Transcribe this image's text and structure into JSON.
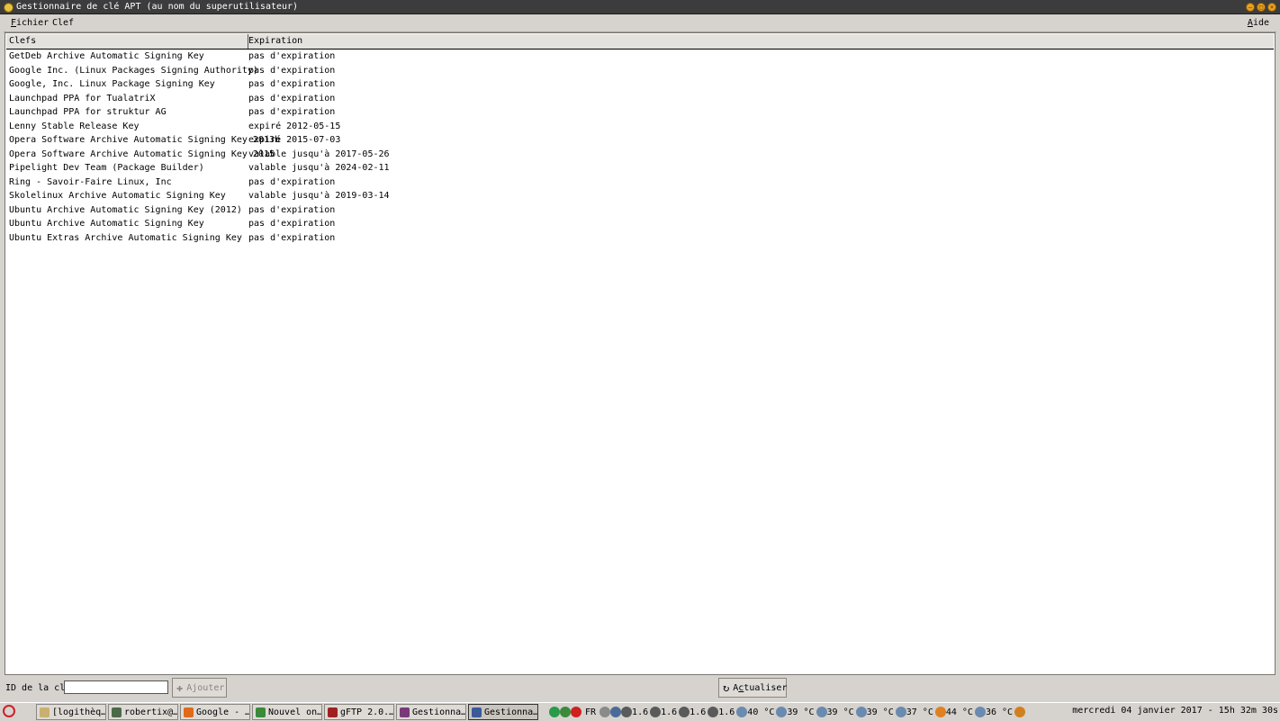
{
  "window": {
    "title": "Gestionnaire de clé APT (au nom du superutilisateur)",
    "buttons": [
      "minimize",
      "maximize",
      "close"
    ]
  },
  "menubar": {
    "file": {
      "mnemonic": "F",
      "rest": "ichier"
    },
    "key": {
      "label": "Clef"
    },
    "help": {
      "mnemonic": "A",
      "rest": "ide"
    }
  },
  "table": {
    "columns": [
      "Clefs",
      "Expiration"
    ],
    "rows": [
      [
        "GetDeb Archive Automatic Signing Key",
        "pas d'expiration"
      ],
      [
        "Google Inc. (Linux Packages Signing Authority)",
        "pas d'expiration"
      ],
      [
        "Google, Inc. Linux Package Signing Key",
        "pas d'expiration"
      ],
      [
        "Launchpad PPA for TualatriX",
        "pas d'expiration"
      ],
      [
        "Launchpad PPA for struktur AG",
        "pas d'expiration"
      ],
      [
        "Lenny Stable Release Key",
        "expiré 2012-05-15"
      ],
      [
        "Opera Software Archive Automatic Signing Key 2013b",
        "expiré 2015-07-03"
      ],
      [
        "Opera Software Archive Automatic Signing Key 2015",
        "valable jusqu'à 2017-05-26"
      ],
      [
        "Pipelight Dev Team (Package Builder)",
        "valable jusqu'à 2024-02-11"
      ],
      [
        "Ring - Savoir-Faire Linux, Inc",
        "pas d'expiration"
      ],
      [
        "Skolelinux Archive Automatic Signing Key",
        "valable jusqu'à 2019-03-14"
      ],
      [
        "Ubuntu Archive Automatic Signing Key (2012)",
        "pas d'expiration"
      ],
      [
        "Ubuntu Archive Automatic Signing Key",
        "pas d'expiration"
      ],
      [
        "Ubuntu Extras Archive Automatic Signing Key",
        "pas d'expiration"
      ]
    ]
  },
  "bottombar": {
    "id_label": "ID de la clé",
    "id_value": "",
    "add_label": "Ajouter",
    "refresh_mnemonic": "c",
    "refresh_pre": "A",
    "refresh_post": "tualiser"
  },
  "taskbar": {
    "tasks": [
      {
        "label": "[logithèq…",
        "icon": "folder-icon",
        "color": "#c8b070"
      },
      {
        "label": "robertix@…",
        "icon": "terminal-icon",
        "color": "#4a6a4a"
      },
      {
        "label": "Google - …",
        "icon": "firefox-icon",
        "color": "#e06a1a"
      },
      {
        "label": "Nouvel on…",
        "icon": "chrome-icon",
        "color": "#3a8a3a"
      },
      {
        "label": "gFTP 2.0.…",
        "icon": "gftp-icon",
        "color": "#a02020"
      },
      {
        "label": "Gestionna…",
        "icon": "key-manager-icon",
        "color": "#7a3a7a"
      },
      {
        "label": "Gestionna…",
        "icon": "window-icon",
        "color": "#3a5a9a",
        "active": true
      }
    ],
    "tray": {
      "lang": "FR",
      "cpu_freqs": [
        "1.6",
        "1.6",
        "1.6",
        "1.6"
      ],
      "temps": [
        "40 °C",
        "39 °C",
        "39 °C",
        "39 °C",
        "37 °C",
        "44 °C",
        "36 °C"
      ],
      "clock": "mercredi 04 janvier 2017 - 15h 32m 30s"
    },
    "colors": {
      "status_green": "#2a9a4a",
      "alert_red": "#d02020"
    }
  }
}
